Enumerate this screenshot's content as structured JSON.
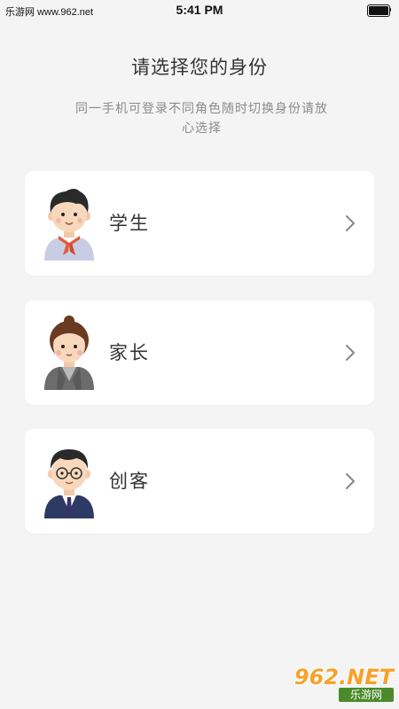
{
  "status_bar": {
    "carrier": "乐游网 www.962.net",
    "time": "5:41 PM"
  },
  "header": {
    "title": "请选择您的身份",
    "subtitle": "同一手机可登录不同角色随时切换身份请放心选择"
  },
  "roles": [
    {
      "label": "学生",
      "avatar": "student-avatar",
      "chevron": "chevron-right-icon"
    },
    {
      "label": "家长",
      "avatar": "parent-avatar",
      "chevron": "chevron-right-icon"
    },
    {
      "label": "创客",
      "avatar": "maker-avatar",
      "chevron": "chevron-right-icon"
    }
  ],
  "watermark": {
    "brand": "962.NET",
    "name": "乐游网"
  },
  "colors": {
    "background": "#f4f4f4",
    "card": "#ffffff",
    "title": "#333333",
    "subtitle": "#8a8a8a",
    "chevron": "#888888"
  }
}
